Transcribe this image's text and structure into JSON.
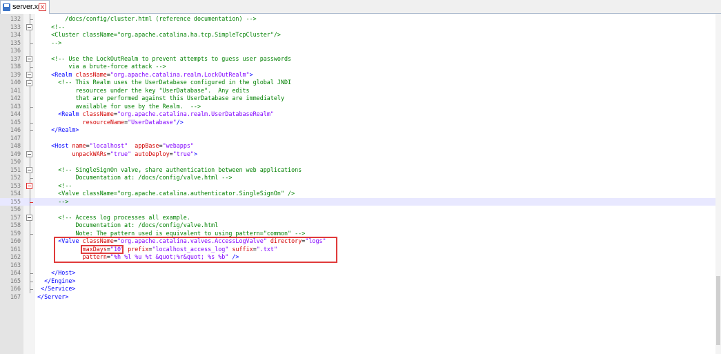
{
  "tab": {
    "label": "server.xml",
    "close_label": "x"
  },
  "editor": {
    "current_line": "155",
    "lines": [
      {
        "n": "132",
        "segs": [
          [
            "c",
            "        /docs/config/cluster.html (reference documentation) -->"
          ]
        ]
      },
      {
        "n": "133",
        "segs": [
          [
            "c",
            "    <!--"
          ]
        ]
      },
      {
        "n": "134",
        "segs": [
          [
            "c",
            "    <Cluster className=\"org.apache.catalina.ha.tcp.SimpleTcpCluster\"/>"
          ]
        ]
      },
      {
        "n": "135",
        "segs": [
          [
            "c",
            "    -->"
          ]
        ]
      },
      {
        "n": "136",
        "segs": []
      },
      {
        "n": "137",
        "segs": [
          [
            "c",
            "    <!-- Use the LockOutRealm to prevent attempts to guess user passwords"
          ]
        ]
      },
      {
        "n": "138",
        "segs": [
          [
            "c",
            "         via a brute-force attack -->"
          ]
        ]
      },
      {
        "n": "139",
        "segs": [
          [
            "k",
            "    "
          ],
          [
            "b",
            "<Realm "
          ],
          [
            "r",
            "className"
          ],
          [
            "k",
            "="
          ],
          [
            "p",
            "\"org.apache.catalina.realm.LockOutRealm\""
          ],
          [
            "b",
            ">"
          ]
        ]
      },
      {
        "n": "140",
        "segs": [
          [
            "c",
            "      <!-- This Realm uses the UserDatabase configured in the global JNDI"
          ]
        ]
      },
      {
        "n": "141",
        "segs": [
          [
            "c",
            "           resources under the key \"UserDatabase\".  Any edits"
          ]
        ]
      },
      {
        "n": "142",
        "segs": [
          [
            "c",
            "           that are performed against this UserDatabase are immediately"
          ]
        ]
      },
      {
        "n": "143",
        "segs": [
          [
            "c",
            "           available for use by the Realm.  -->"
          ]
        ]
      },
      {
        "n": "144",
        "segs": [
          [
            "k",
            "      "
          ],
          [
            "b",
            "<Realm "
          ],
          [
            "r",
            "className"
          ],
          [
            "k",
            "="
          ],
          [
            "p",
            "\"org.apache.catalina.realm.UserDatabaseRealm\""
          ]
        ]
      },
      {
        "n": "145",
        "segs": [
          [
            "k",
            "             "
          ],
          [
            "r",
            "resourceName"
          ],
          [
            "k",
            "="
          ],
          [
            "p",
            "\"UserDatabase\""
          ],
          [
            "b",
            "/>"
          ]
        ]
      },
      {
        "n": "146",
        "segs": [
          [
            "k",
            "    "
          ],
          [
            "b",
            "</Realm>"
          ]
        ]
      },
      {
        "n": "147",
        "segs": []
      },
      {
        "n": "148",
        "segs": [
          [
            "k",
            "    "
          ],
          [
            "b",
            "<Host "
          ],
          [
            "r",
            "name"
          ],
          [
            "k",
            "="
          ],
          [
            "p",
            "\"localhost\""
          ],
          [
            "k",
            "  "
          ],
          [
            "r",
            "appBase"
          ],
          [
            "k",
            "="
          ],
          [
            "p",
            "\"webapps\""
          ]
        ]
      },
      {
        "n": "149",
        "segs": [
          [
            "k",
            "          "
          ],
          [
            "r",
            "unpackWARs"
          ],
          [
            "k",
            "="
          ],
          [
            "p",
            "\"true\""
          ],
          [
            "k",
            " "
          ],
          [
            "r",
            "autoDeploy"
          ],
          [
            "k",
            "="
          ],
          [
            "p",
            "\"true\""
          ],
          [
            "b",
            ">"
          ]
        ]
      },
      {
        "n": "150",
        "segs": []
      },
      {
        "n": "151",
        "segs": [
          [
            "c",
            "      <!-- SingleSignOn valve, share authentication between web applications"
          ]
        ]
      },
      {
        "n": "152",
        "segs": [
          [
            "c",
            "           Documentation at: /docs/config/valve.html -->"
          ]
        ]
      },
      {
        "n": "153",
        "segs": [
          [
            "c",
            "      <!--"
          ]
        ]
      },
      {
        "n": "154",
        "segs": [
          [
            "c",
            "      <Valve className=\"org.apache.catalina.authenticator.SingleSignOn\" />"
          ]
        ]
      },
      {
        "n": "155",
        "segs": [
          [
            "c",
            "      -->"
          ]
        ]
      },
      {
        "n": "156",
        "segs": []
      },
      {
        "n": "157",
        "segs": [
          [
            "c",
            "      <!-- Access log processes all example."
          ]
        ]
      },
      {
        "n": "158",
        "segs": [
          [
            "c",
            "           Documentation at: /docs/config/valve.html"
          ]
        ]
      },
      {
        "n": "159",
        "segs": [
          [
            "c",
            "           Note: The pattern used is equivalent to using pattern=\"common\" -->"
          ]
        ]
      },
      {
        "n": "160",
        "segs": [
          [
            "k",
            "      "
          ],
          [
            "b",
            "<Valve "
          ],
          [
            "r",
            "className"
          ],
          [
            "k",
            "="
          ],
          [
            "p",
            "\"org.apache.catalina.valves.AccessLogValve\""
          ],
          [
            "k",
            " "
          ],
          [
            "r",
            "directory"
          ],
          [
            "k",
            "="
          ],
          [
            "p",
            "\"logs\""
          ]
        ]
      },
      {
        "n": "161",
        "segs": [
          [
            "k",
            "             "
          ],
          [
            "r",
            "maxDays"
          ],
          [
            "k",
            "="
          ],
          [
            "p",
            "\"10\""
          ],
          [
            "k",
            " "
          ],
          [
            "r",
            "prefix"
          ],
          [
            "k",
            "="
          ],
          [
            "p",
            "\"localhost_access_log\""
          ],
          [
            "k",
            " "
          ],
          [
            "r",
            "suffix"
          ],
          [
            "k",
            "="
          ],
          [
            "p",
            "\".txt\""
          ]
        ]
      },
      {
        "n": "162",
        "segs": [
          [
            "k",
            "             "
          ],
          [
            "r",
            "pattern"
          ],
          [
            "k",
            "="
          ],
          [
            "p",
            "\"%h %l %u %t &quot;%r&quot; %s %b\""
          ],
          [
            "k",
            " "
          ],
          [
            "b",
            "/>"
          ]
        ]
      },
      {
        "n": "163",
        "segs": []
      },
      {
        "n": "164",
        "segs": [
          [
            "k",
            "    "
          ],
          [
            "b",
            "</Host>"
          ]
        ]
      },
      {
        "n": "165",
        "segs": [
          [
            "k",
            "  "
          ],
          [
            "b",
            "</Engine>"
          ]
        ]
      },
      {
        "n": "166",
        "segs": [
          [
            "k",
            " "
          ],
          [
            "b",
            "</Service>"
          ]
        ]
      },
      {
        "n": "167",
        "segs": [
          [
            "b",
            "</Server>"
          ]
        ]
      }
    ]
  },
  "colors": {
    "comment": "#008000",
    "tag": "#0000ff",
    "attribute": "#d20000",
    "value": "#8000ff",
    "highlight_box": "#e03a3a",
    "current_line": "#e8e8ff"
  }
}
